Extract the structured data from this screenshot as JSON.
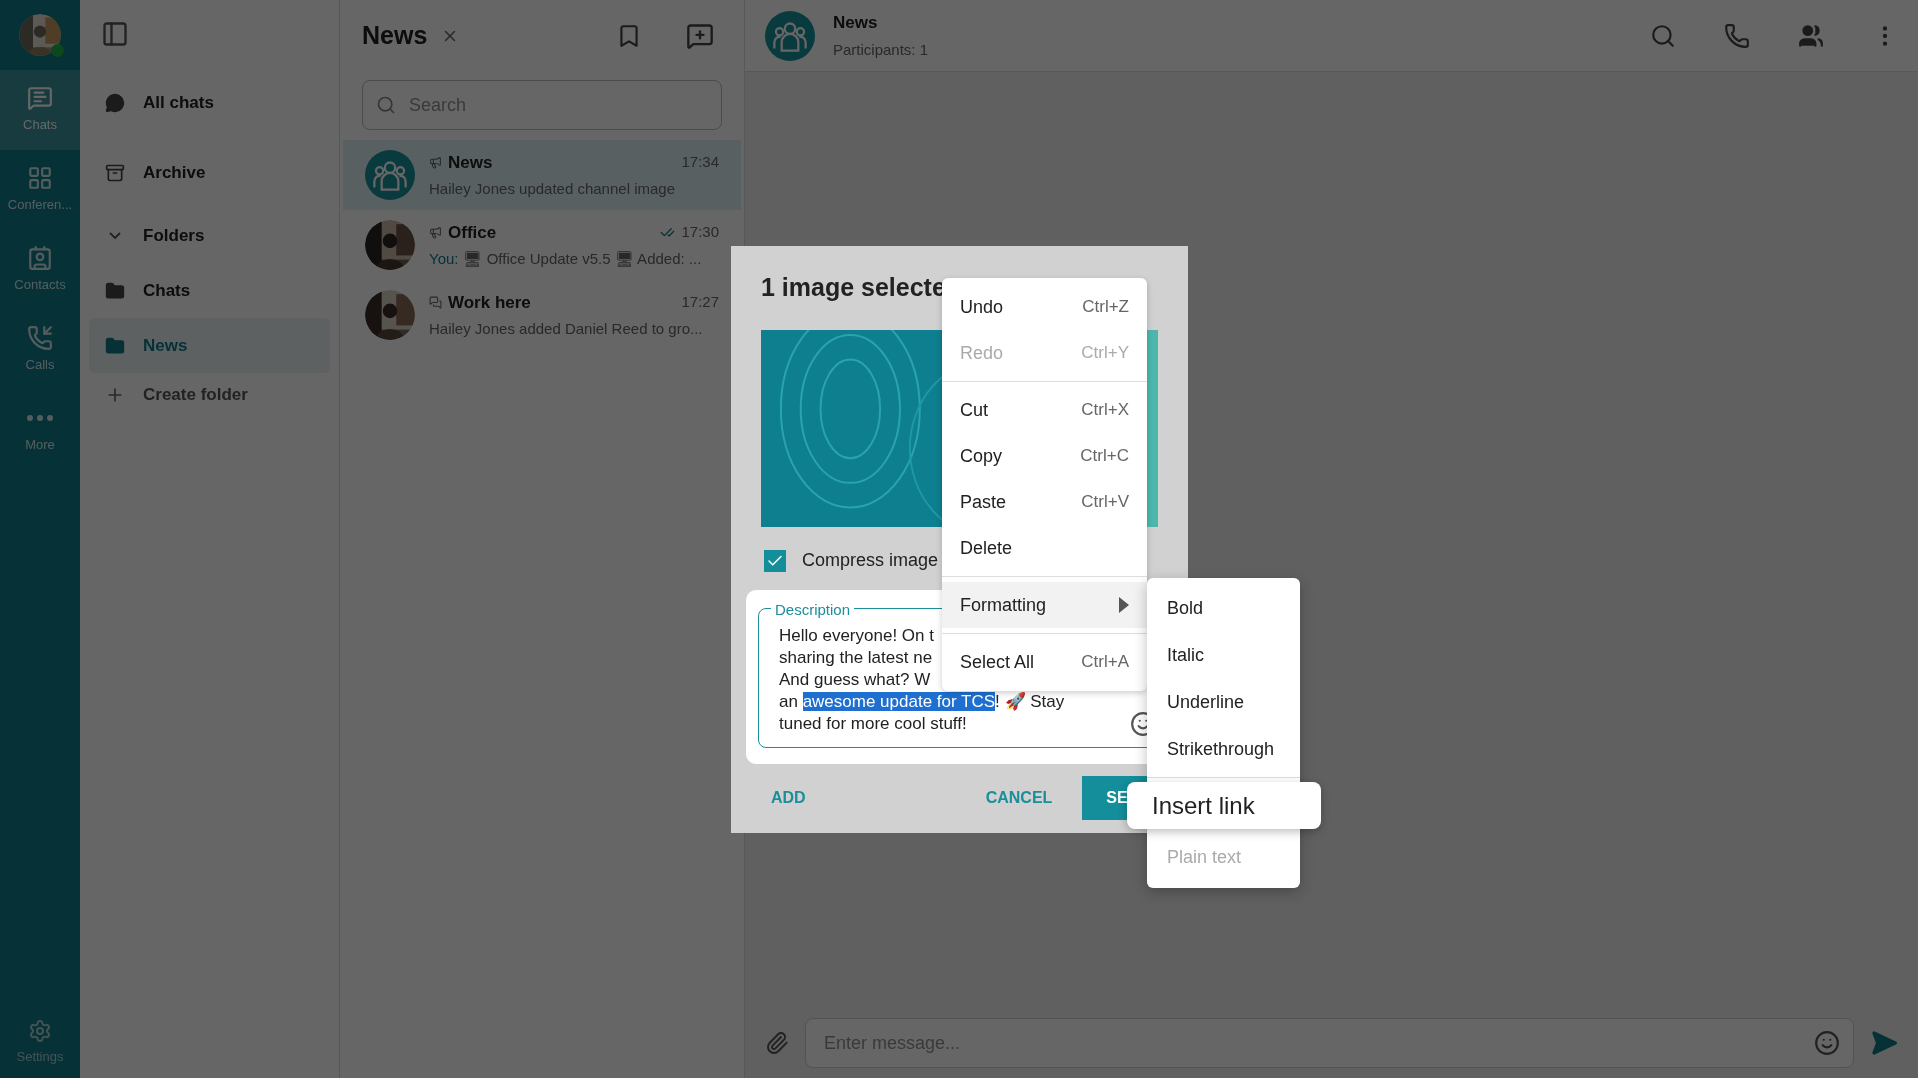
{
  "nav_rail": {
    "profile": {
      "online": true
    },
    "items": [
      {
        "kind": "chats",
        "label": "Chats",
        "selected": true
      },
      {
        "kind": "conferences",
        "label": "Conferen...",
        "selected": false
      },
      {
        "kind": "contacts",
        "label": "Contacts",
        "selected": false
      },
      {
        "kind": "calls",
        "label": "Calls",
        "selected": false
      },
      {
        "kind": "more",
        "label": "More",
        "selected": false
      }
    ],
    "settings": "Settings"
  },
  "folders_panel": {
    "items": [
      {
        "kind": "all",
        "label": "All chats",
        "selected": false
      },
      {
        "kind": "archive",
        "label": "Archive",
        "selected": false
      },
      {
        "kind": "group",
        "label": "Folders",
        "expanded": true
      },
      {
        "kind": "folder",
        "label": "Chats",
        "selected": false
      },
      {
        "kind": "folder",
        "label": "News",
        "selected": true
      },
      {
        "kind": "create",
        "label": "Create folder"
      }
    ]
  },
  "chat_list": {
    "title": "News",
    "search": {
      "placeholder": "Search"
    },
    "chats": [
      {
        "kind": "channel",
        "avatar": {
          "kind": "group"
        },
        "name": "News",
        "time": "17:34",
        "read": false,
        "preview": "Hailey Jones updated channel image",
        "selected": true
      },
      {
        "kind": "channel",
        "name": "Office",
        "time": "17:30",
        "read": true,
        "prefix": "You:",
        "preview": "🖥 Office Update v5.5 🖥  Added: ...",
        "selected": false
      },
      {
        "kind": "group",
        "name": "Work here",
        "time": "17:27",
        "read": false,
        "preview": "Hailey Jones added Daniel Reed to gro...",
        "selected": false
      }
    ]
  },
  "chat_header": {
    "title": "News",
    "subtitle": "Participants: 1"
  },
  "composer": {
    "placeholder": "Enter message..."
  },
  "dialog": {
    "title": "1 image selecte",
    "compress_image": {
      "label": "Compress image",
      "checked": true
    },
    "description": {
      "label": "Description",
      "lines": [
        [
          {
            "text": "Hello everyone! On t",
            "selected": false
          }
        ],
        [
          {
            "text": "sharing the latest ne",
            "selected": false
          }
        ],
        [
          {
            "text": "And guess what? W",
            "selected": false
          }
        ],
        [
          {
            "text": "an ",
            "selected": false
          },
          {
            "text": "awesome update for TCS",
            "selected": true
          },
          {
            "text": "! 🚀 Stay",
            "selected": false
          }
        ],
        [
          {
            "text": "tuned for more cool stuff!",
            "selected": false
          }
        ]
      ]
    },
    "buttons": [
      {
        "kind": "text",
        "label": "ADD"
      },
      {
        "kind": "text",
        "label": "CANCEL"
      },
      {
        "kind": "primary",
        "label": "SE"
      }
    ]
  },
  "context_menu": {
    "items": [
      {
        "kind": "item",
        "label": "Undo",
        "shortcut": "Ctrl+Z",
        "disabled": false
      },
      {
        "kind": "item",
        "label": "Redo",
        "shortcut": "Ctrl+Y",
        "disabled": true
      },
      {
        "kind": "divider"
      },
      {
        "kind": "item",
        "label": "Cut",
        "shortcut": "Ctrl+X",
        "disabled": false
      },
      {
        "kind": "item",
        "label": "Copy",
        "shortcut": "Ctrl+C",
        "disabled": false
      },
      {
        "kind": "item",
        "label": "Paste",
        "shortcut": "Ctrl+V",
        "disabled": false
      },
      {
        "kind": "item",
        "label": "Delete",
        "disabled": false
      },
      {
        "kind": "divider"
      },
      {
        "kind": "submenu",
        "label": "Formatting",
        "selected": true
      },
      {
        "kind": "divider"
      },
      {
        "kind": "item",
        "label": "Select All",
        "shortcut": "Ctrl+A",
        "disabled": false
      }
    ]
  },
  "submenu": {
    "items": [
      {
        "kind": "item",
        "label": "Bold",
        "disabled": false,
        "selected": false
      },
      {
        "kind": "item",
        "label": "Italic",
        "disabled": false,
        "selected": false
      },
      {
        "kind": "item",
        "label": "Underline",
        "disabled": false,
        "selected": false
      },
      {
        "kind": "item",
        "label": "Strikethrough",
        "disabled": false,
        "selected": false
      },
      {
        "kind": "divider"
      },
      {
        "kind": "item",
        "label": "Insert link",
        "disabled": false,
        "selected": true
      },
      {
        "kind": "item",
        "label": "Plain text",
        "disabled": true,
        "selected": false
      }
    ]
  }
}
